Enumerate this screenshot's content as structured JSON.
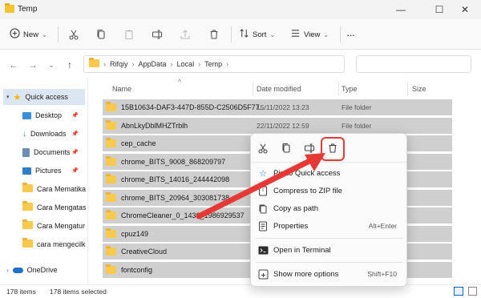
{
  "window": {
    "title": "Temp",
    "minimize_glyph": "—",
    "maximize_glyph": "☐",
    "close_glyph": "✕"
  },
  "toolbar": {
    "new_label": "New",
    "sort_label": "Sort",
    "view_label": "View",
    "more_glyph": "···",
    "chevron": "⌄"
  },
  "address": {
    "crumbs": [
      "Rifqiy",
      "AppData",
      "Local",
      "Temp"
    ],
    "separator": "›",
    "back_glyph": "←",
    "forward_glyph": "→",
    "recent_glyph": "⌄",
    "up_glyph": "↑"
  },
  "nav": {
    "quick_access": "Quick access",
    "items": [
      "Desktop",
      "Downloads",
      "Documents",
      "Pictures",
      "Cara Mematika",
      "Cara Mengatas",
      "Cara Mengatur",
      "cara mengecilk"
    ],
    "onedrive": "OneDrive",
    "pin_glyph": "📌"
  },
  "columns": {
    "name": "Name",
    "date": "Date modified",
    "type": "Type",
    "size": "Size",
    "sort_glyph": "^"
  },
  "rows": [
    {
      "name": "15B10634-DAF3-447D-855D-C2506D5F77...",
      "date": "15/11/2022 13:23",
      "type": "File folder"
    },
    {
      "name": "AbnLkyDblMHZTrblh",
      "date": "22/11/2022 12:59",
      "type": "File folder"
    },
    {
      "name": "cep_cache",
      "date": "",
      "type": ""
    },
    {
      "name": "chrome_BITS_9008_868209797",
      "date": "",
      "type": ""
    },
    {
      "name": "chrome_BITS_14016_244442098",
      "date": "",
      "type": ""
    },
    {
      "name": "chrome_BITS_20964_303081738",
      "date": "",
      "type": ""
    },
    {
      "name": "ChromeCleaner_0_1436_1986929537",
      "date": "",
      "type": ""
    },
    {
      "name": "cpuz149",
      "date": "",
      "type": ""
    },
    {
      "name": "CreativeCloud",
      "date": "",
      "type": ""
    },
    {
      "name": "fontconfig",
      "date": "",
      "type": ""
    }
  ],
  "status": {
    "count": "178 items",
    "selected": "178 items selected"
  },
  "context_menu": {
    "items": [
      {
        "label": "Pin to Quick access",
        "shortcut": ""
      },
      {
        "label": "Compress to ZIP file",
        "shortcut": ""
      },
      {
        "label": "Copy as path",
        "shortcut": ""
      },
      {
        "label": "Properties",
        "shortcut": "Alt+Enter"
      },
      {
        "label": "Open in Terminal",
        "shortcut": ""
      },
      {
        "label": "Show more options",
        "shortcut": "Shift+F10"
      }
    ]
  },
  "colors": {
    "accent": "#0067c0",
    "selection_row": "#cfcfcf",
    "highlight": "#e53935"
  }
}
